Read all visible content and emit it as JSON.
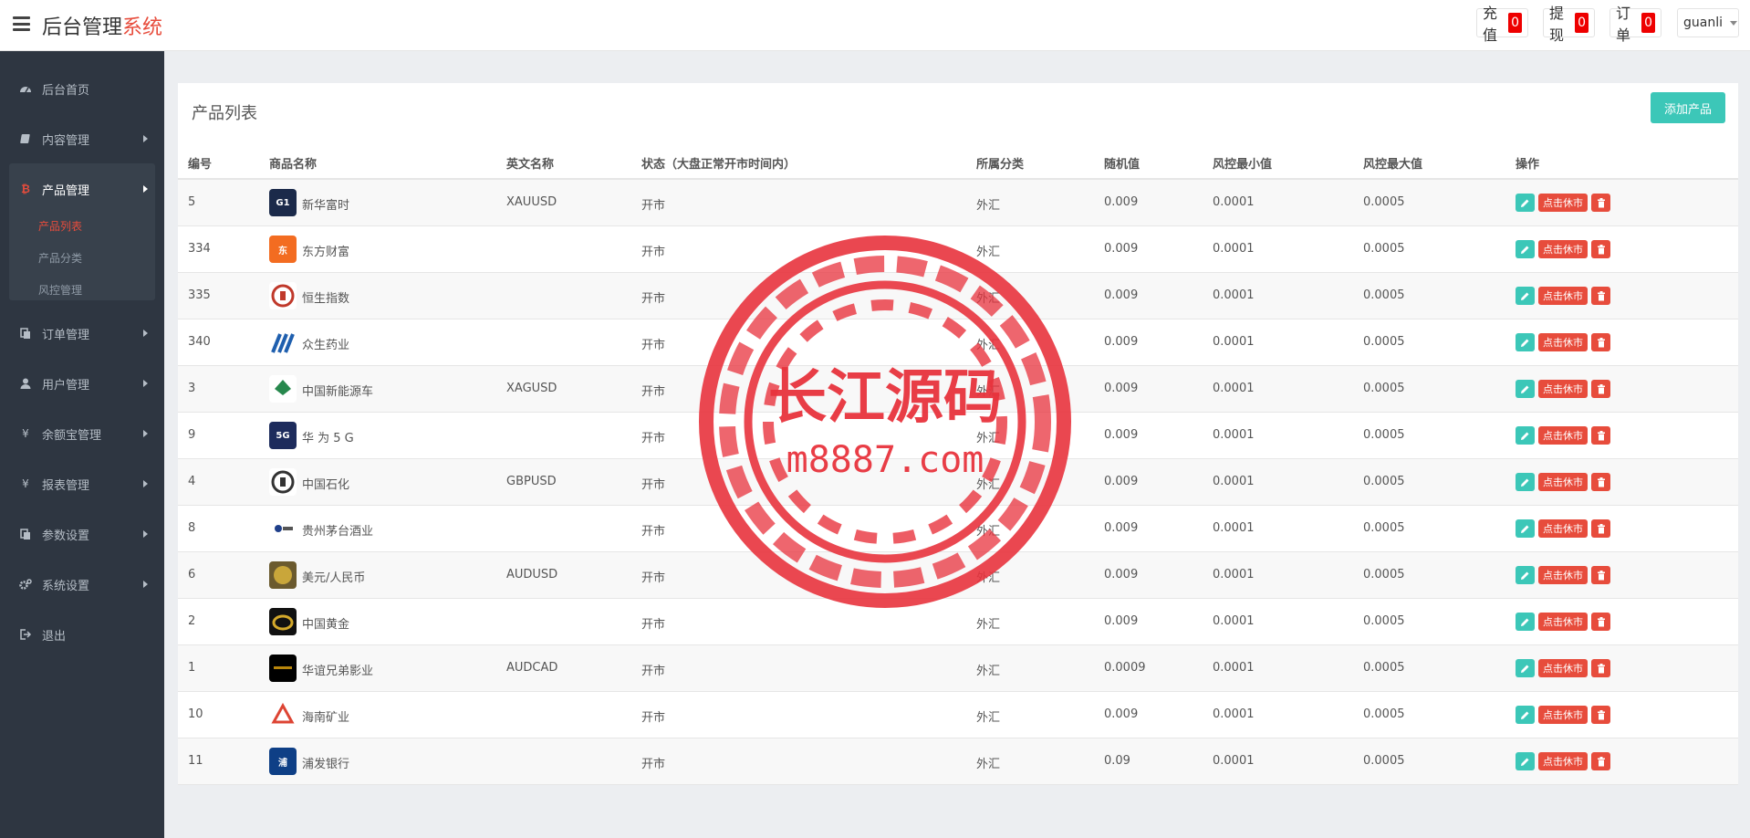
{
  "brand": {
    "main": "后台管理",
    "accent": "系统"
  },
  "top_buttons": {
    "recharge": {
      "label": "充值",
      "count": "0"
    },
    "withdraw": {
      "label": "提现",
      "count": "0"
    },
    "orders": {
      "label": "订单",
      "count": "0"
    },
    "user": {
      "label": "guanli"
    }
  },
  "sidebar": {
    "items": [
      {
        "label": "后台首页",
        "icon": "dashboard-icon"
      },
      {
        "label": "内容管理",
        "icon": "book-icon"
      },
      {
        "label": "产品管理",
        "icon": "bitcoin-icon"
      },
      {
        "label": "订单管理",
        "icon": "copy-icon"
      },
      {
        "label": "用户管理",
        "icon": "user-icon"
      },
      {
        "label": "余额宝管理",
        "icon": "yen-icon"
      },
      {
        "label": "报表管理",
        "icon": "yen-icon"
      },
      {
        "label": "参数设置",
        "icon": "copy-icon"
      },
      {
        "label": "系统设置",
        "icon": "gears-icon"
      },
      {
        "label": "退出",
        "icon": "sign-out-icon"
      }
    ],
    "sub_items": [
      "产品列表",
      "产品分类",
      "风控管理"
    ]
  },
  "panel": {
    "title": "产品列表",
    "add_button": "添加产品"
  },
  "table": {
    "headers": [
      "编号",
      "商品名称",
      "英文名称",
      "状态（大盘正常开市时间内）",
      "所属分类",
      "随机值",
      "风控最小值",
      "风控最大值",
      "操作"
    ],
    "rows": [
      {
        "id": "5",
        "name": "新华富时",
        "en": "XAUUSD",
        "status": "开市",
        "category": "外汇",
        "random": "0.009",
        "min": "0.0001",
        "max": "0.0005"
      },
      {
        "id": "334",
        "name": "东方财富",
        "en": "",
        "status": "开市",
        "category": "外汇",
        "random": "0.009",
        "min": "0.0001",
        "max": "0.0005"
      },
      {
        "id": "335",
        "name": "恒生指数",
        "en": "",
        "status": "开市",
        "category": "外汇",
        "random": "0.009",
        "min": "0.0001",
        "max": "0.0005"
      },
      {
        "id": "340",
        "name": "众生药业",
        "en": "",
        "status": "开市",
        "category": "外汇",
        "random": "0.009",
        "min": "0.0001",
        "max": "0.0005"
      },
      {
        "id": "3",
        "name": "中国新能源车",
        "en": "XAGUSD",
        "status": "开市",
        "category": "外汇",
        "random": "0.009",
        "min": "0.0001",
        "max": "0.0005"
      },
      {
        "id": "9",
        "name": "华 为 5 G",
        "en": "",
        "status": "开市",
        "category": "外汇",
        "random": "0.009",
        "min": "0.0001",
        "max": "0.0005"
      },
      {
        "id": "4",
        "name": "中国石化",
        "en": "GBPUSD",
        "status": "开市",
        "category": "外汇",
        "random": "0.009",
        "min": "0.0001",
        "max": "0.0005"
      },
      {
        "id": "8",
        "name": "贵州茅台酒业",
        "en": "",
        "status": "开市",
        "category": "外汇",
        "random": "0.009",
        "min": "0.0001",
        "max": "0.0005"
      },
      {
        "id": "6",
        "name": "美元/人民币",
        "en": "AUDUSD",
        "status": "开市",
        "category": "外汇",
        "random": "0.009",
        "min": "0.0001",
        "max": "0.0005"
      },
      {
        "id": "2",
        "name": "中国黄金",
        "en": "",
        "status": "开市",
        "category": "外汇",
        "random": "0.009",
        "min": "0.0001",
        "max": "0.0005"
      },
      {
        "id": "1",
        "name": "华谊兄弟影业",
        "en": "AUDCAD",
        "status": "开市",
        "category": "外汇",
        "random": "0.0009",
        "min": "0.0001",
        "max": "0.0005"
      },
      {
        "id": "10",
        "name": "海南矿业",
        "en": "",
        "status": "开市",
        "category": "外汇",
        "random": "0.009",
        "min": "0.0001",
        "max": "0.0005"
      },
      {
        "id": "11",
        "name": "浦发银行",
        "en": "",
        "status": "开市",
        "category": "外汇",
        "random": "0.09",
        "min": "0.0001",
        "max": "0.0005"
      }
    ],
    "op_rest_label": "点击休市"
  },
  "watermark": {
    "line1": "长江源码",
    "line2": "m8887.com"
  },
  "colors": {
    "accent": "#e74c3c",
    "teal": "#3cc7b8",
    "sidebar": "#2e3641"
  }
}
